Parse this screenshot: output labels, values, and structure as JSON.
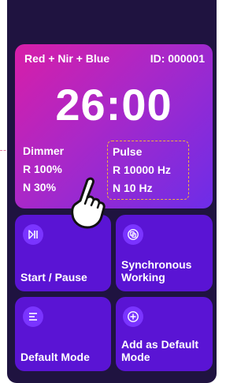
{
  "card": {
    "mode": "Red + Nir + Blue",
    "device_id": "ID: 000001",
    "timer": "26:00",
    "dimmer_title": "Dimmer",
    "dimmer_r": "R 100%",
    "dimmer_n": "N 30%",
    "pulse_title": "Pulse",
    "pulse_r": "R 10000 Hz",
    "pulse_n": "N 10 Hz"
  },
  "tiles": {
    "start_pause": "Start / Pause",
    "synchronous": "Synchronous Working",
    "default_mode": "Default Mode",
    "add_default": "Add as Default Mode"
  },
  "icons": {
    "start_pause": "play-pause-icon",
    "synchronous": "sync-copy-icon",
    "default_mode": "menu-lines-icon",
    "add_default": "plus-circle-icon",
    "pointer": "pointing-hand-icon"
  },
  "colors": {
    "background": "#1f1340",
    "card_gradient_start": "#d81ea8",
    "card_gradient_end": "#6d2de8",
    "tile": "#5a14d4",
    "tile_icon": "#7a34ff",
    "highlight_dash": "#f0b43c"
  }
}
